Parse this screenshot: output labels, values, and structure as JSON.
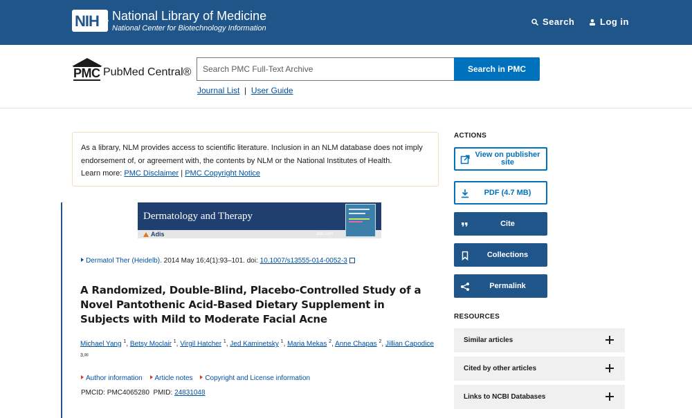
{
  "nih_header": {
    "logo_text": "NIH",
    "title": "National Library of Medicine",
    "subtitle": "National Center for Biotechnology Information",
    "search_label": "Search",
    "login_label": "Log in",
    "background_color": "#20558a"
  },
  "pmc_header": {
    "logo_mark": "PMC",
    "logo_name": "PubMed Central®",
    "search_placeholder": "Search PMC Full-Text Archive",
    "search_button": "Search in PMC",
    "journal_list_link": "Journal List",
    "separator": "|",
    "user_guide_link": "User Guide",
    "accent_color": "#0071bc"
  },
  "disclaimer": {
    "text": "As a library, NLM provides access to scientific literature. Inclusion in an NLM database does not imply endorsement of, or agreement with, the contents by NLM or the National Institutes of Health.",
    "learn_more": "Learn more:",
    "disclaimer_link": "PMC Disclaimer",
    "separator": "|",
    "copyright_link": "PMC Copyright Notice"
  },
  "article": {
    "journal_banner": {
      "name": "Dermatology and Therapy",
      "publisher": "Adis",
      "url": "adis.com"
    },
    "citation": {
      "journal_link": "Dermatol Ther (Heidelb).",
      "details": "2014 May 16;4(1):93–101. doi:",
      "doi": "10.1007/s13555-014-0052-3"
    },
    "title": "A Randomized, Double-Blind, Placebo-Controlled Study of a Novel Pantothenic Acid-Based Dietary Supplement in Subjects with Mild to Moderate Facial Acne",
    "authors": [
      {
        "name": "Michael Yang",
        "sup": "1"
      },
      {
        "name": "Betsy Moclair",
        "sup": "1"
      },
      {
        "name": "Virgil Hatcher",
        "sup": "1"
      },
      {
        "name": "Jed Kaminetsky",
        "sup": "1"
      },
      {
        "name": "Maria Mekas",
        "sup": "2"
      },
      {
        "name": "Anne Chapas",
        "sup": "2"
      },
      {
        "name": "Jillian Capodice",
        "sup": "3,✉"
      }
    ],
    "info_links": [
      "Author information",
      "Article notes",
      "Copyright and License information"
    ],
    "pmcid_label": "PMCID: PMC4065280",
    "pmid_label": "PMID:",
    "pmid": "24831048"
  },
  "actions": {
    "heading": "ACTIONS",
    "view_publisher": "View on publisher site",
    "pdf": "PDF (4.7 MB)",
    "cite": "Cite",
    "collections": "Collections",
    "permalink": "Permalink"
  },
  "resources": {
    "heading": "RESOURCES",
    "items": [
      "Similar articles",
      "Cited by other articles",
      "Links to NCBI Databases"
    ]
  }
}
